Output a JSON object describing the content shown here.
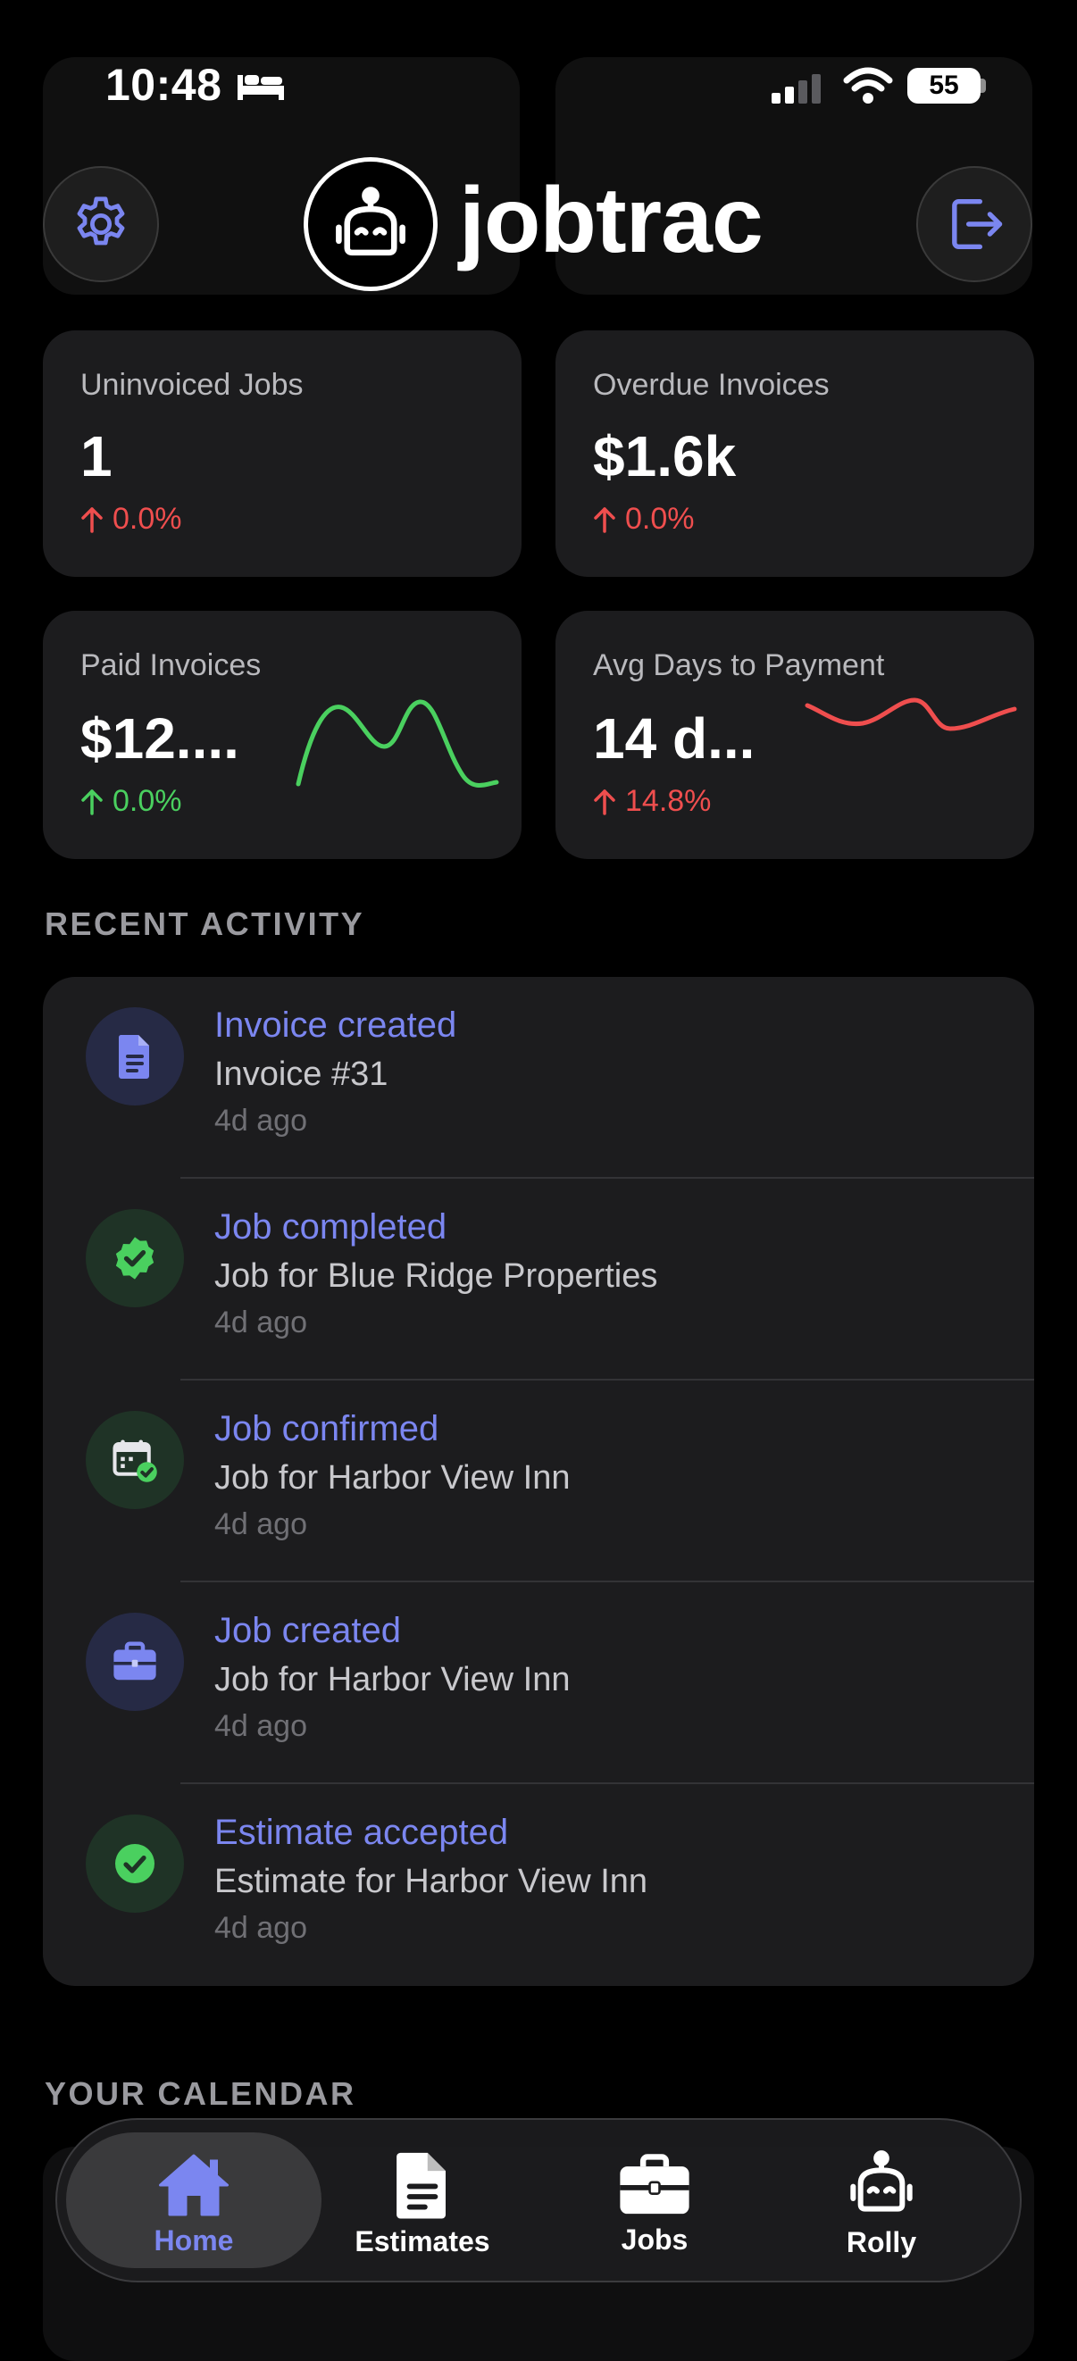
{
  "status_bar": {
    "time": "10:48",
    "battery": "55"
  },
  "header": {
    "app_name": "jobtrac"
  },
  "metrics": [
    {
      "label": "Uninvoiced Jobs",
      "value": "1",
      "change": "0.0%",
      "trend": "up",
      "change_color": "#ef4e4e"
    },
    {
      "label": "Overdue Invoices",
      "value": "$1.6k",
      "change": "0.0%",
      "trend": "up",
      "change_color": "#ef4e4e"
    },
    {
      "label": "Paid Invoices",
      "value": "$12....",
      "change": "0.0%",
      "trend": "up",
      "change_color": "#4ad05f",
      "sparkline_color": "#4ad05f"
    },
    {
      "label": "Avg Days to Payment",
      "value": "14 d...",
      "change": "14.8%",
      "trend": "up",
      "change_color": "#ef4e4e",
      "sparkline_color": "#ef4e4e"
    }
  ],
  "recent_activity": {
    "title": "RECENT ACTIVITY",
    "items": [
      {
        "title": "Invoice created",
        "subtitle": "Invoice #31",
        "time": "4d ago",
        "icon": "document-icon"
      },
      {
        "title": "Job completed",
        "subtitle": "Job for Blue Ridge Properties",
        "time": "4d ago",
        "icon": "verified-badge-icon"
      },
      {
        "title": "Job confirmed",
        "subtitle": "Job for Harbor View Inn",
        "time": "4d ago",
        "icon": "calendar-check-icon"
      },
      {
        "title": "Job created",
        "subtitle": "Job for Harbor View Inn",
        "time": "4d ago",
        "icon": "briefcase-icon"
      },
      {
        "title": "Estimate accepted",
        "subtitle": "Estimate for Harbor View Inn",
        "time": "4d ago",
        "icon": "check-circle-icon"
      }
    ]
  },
  "calendar": {
    "title": "YOUR CALENDAR"
  },
  "tabbar": {
    "tabs": [
      {
        "label": "Home",
        "icon": "home-icon",
        "active": true
      },
      {
        "label": "Estimates",
        "icon": "document-icon",
        "active": false
      },
      {
        "label": "Jobs",
        "icon": "briefcase-icon",
        "active": false
      },
      {
        "label": "Rolly",
        "icon": "robot-icon",
        "active": false
      }
    ]
  },
  "colors": {
    "accent": "#7b86f0",
    "positive": "#4ad05f",
    "negative": "#ef4e4e",
    "card_bg": "#1c1c1e"
  }
}
